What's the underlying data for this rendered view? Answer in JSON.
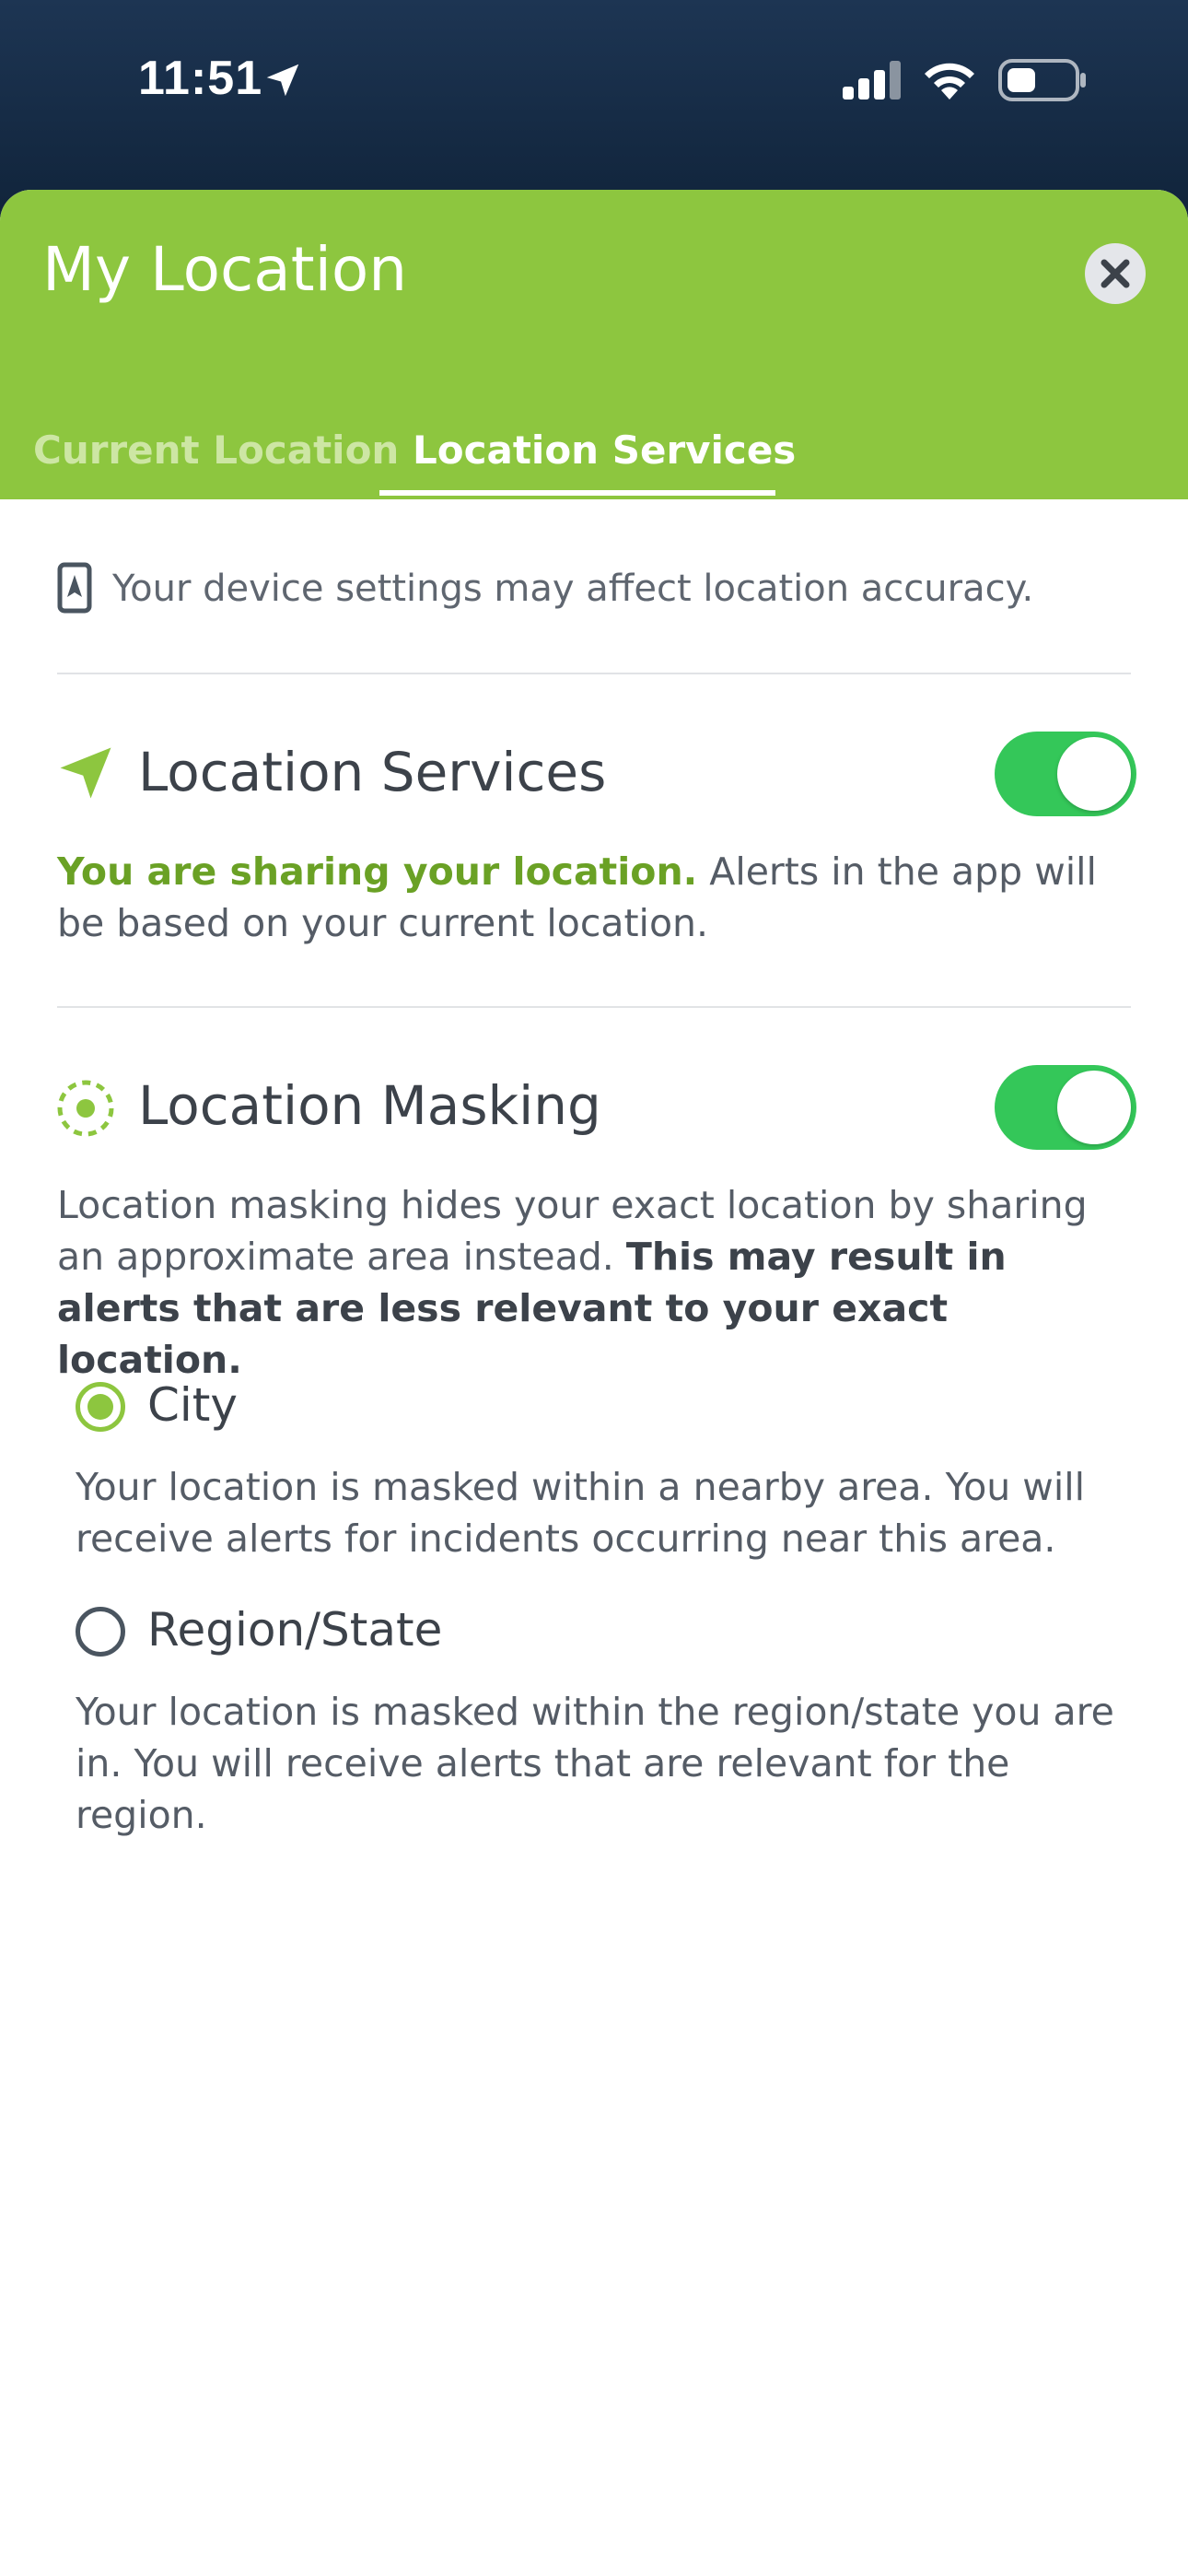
{
  "status_bar": {
    "time": "11:51"
  },
  "header": {
    "title": "My Location",
    "close_icon": "close-icon"
  },
  "tabs": [
    {
      "label": "Current Location",
      "active": false
    },
    {
      "label": "Location Services",
      "active": true
    }
  ],
  "note": {
    "text": "Your device settings may affect location accuracy."
  },
  "location_services": {
    "title": "Location Services",
    "enabled": true,
    "status_strong": "You are sharing your location.",
    "status_rest": "Alerts in the app will be based on your current location."
  },
  "location_masking": {
    "title": "Location Masking",
    "enabled": true,
    "desc_plain": "Location masking hides your exact location by sharing an approximate area instead.",
    "desc_strong": "This may result in alerts that are less relevant to your exact location.",
    "options": [
      {
        "label": "City",
        "selected": true,
        "description": "Your location is masked within a nearby area. You will receive alerts for incidents occurring near this area."
      },
      {
        "label": "Region/State",
        "selected": false,
        "description": "Your location is masked within the region/state you are in. You will receive alerts that are relevant for the region."
      }
    ]
  },
  "colors": {
    "brand_green": "#8dc63f",
    "toggle_green": "#34c759",
    "status_bar_bg": "#1d3553"
  }
}
